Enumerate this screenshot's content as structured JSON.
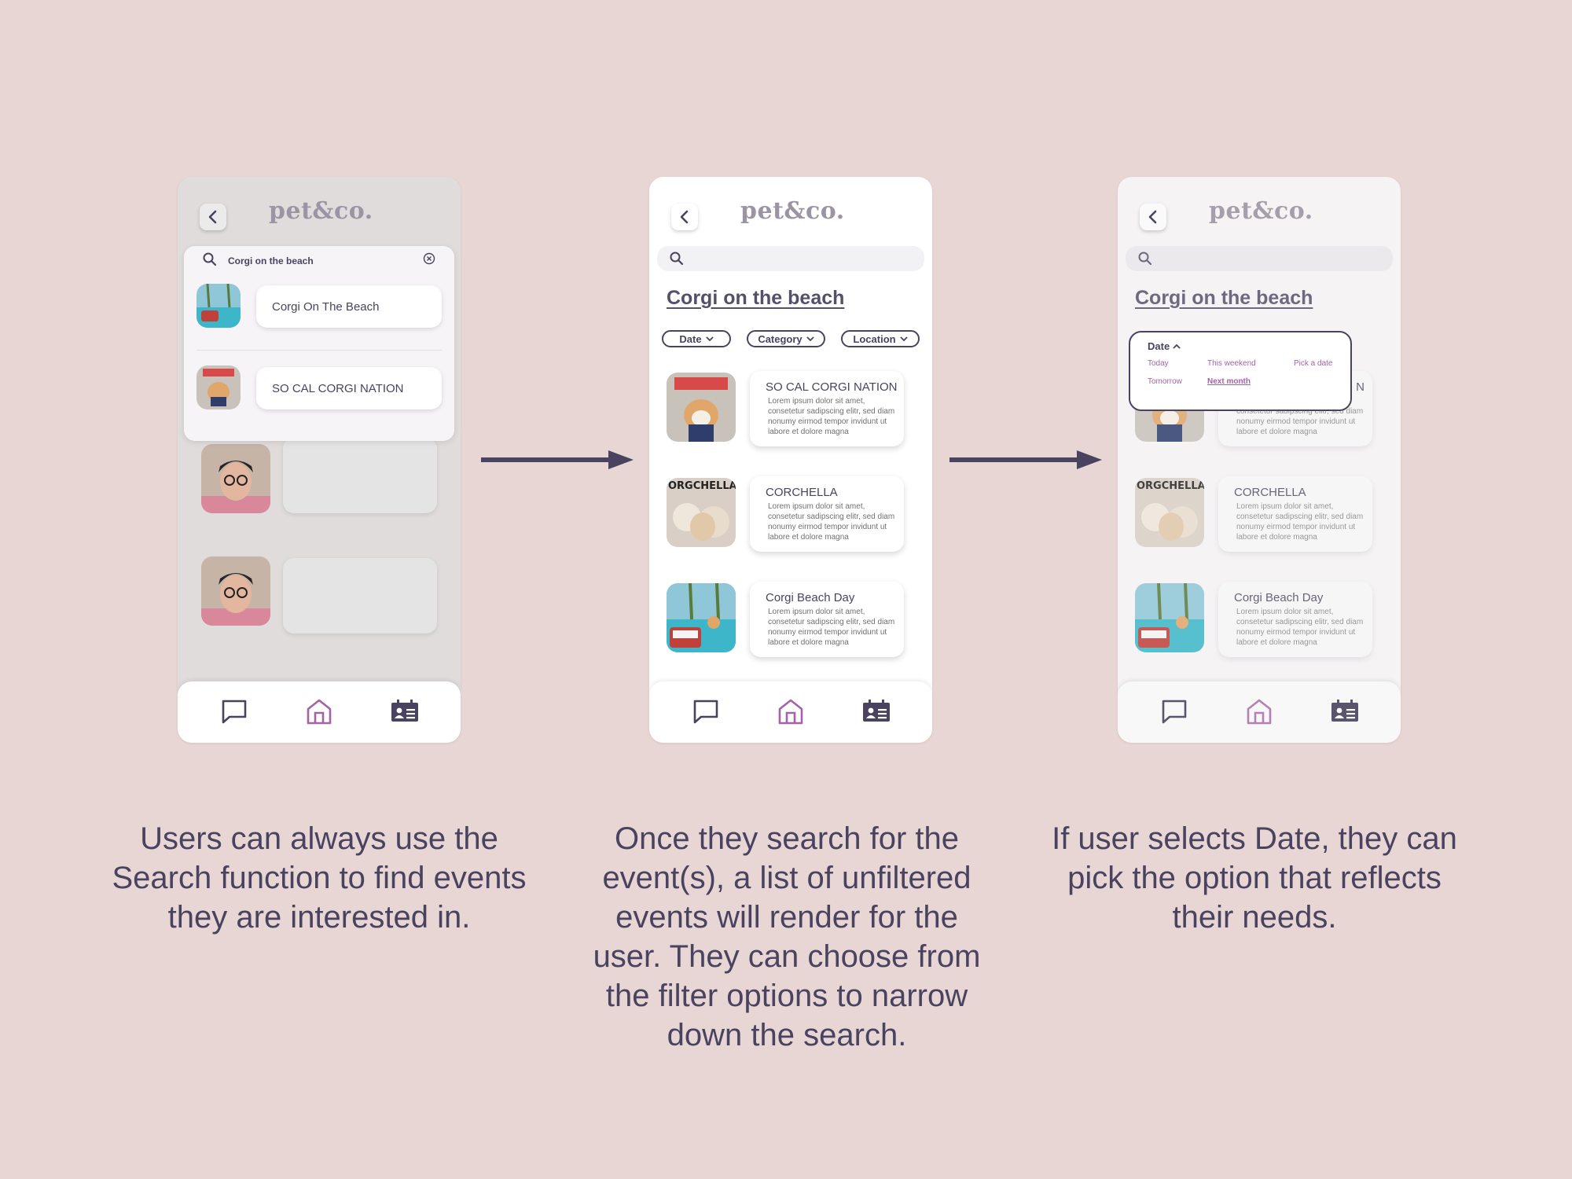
{
  "brand": {
    "logo": "pet&co.",
    "accent": "#a463a4",
    "dark": "#4a4360",
    "background": "#e8d6d4"
  },
  "screen1": {
    "search_query": "Corgi on the beach",
    "results": [
      {
        "label": "Corgi On The Beach"
      },
      {
        "label": "SO CAL CORGI NATION"
      }
    ]
  },
  "screen2": {
    "heading": "Corgi on the beach",
    "filters": [
      {
        "label": "Date"
      },
      {
        "label": "Category"
      },
      {
        "label": "Location"
      }
    ],
    "events": [
      {
        "title": "SO CAL CORGI NATION",
        "desc": "Lorem ipsum dolor sit amet, consetetur sadipscing elitr, sed diam nonumy eirmod tempor invidunt ut labore et dolore magna"
      },
      {
        "title": "CORCHELLA",
        "desc": "Lorem ipsum dolor sit amet, consetetur sadipscing elitr, sed diam nonumy eirmod tempor invidunt ut labore et dolore magna"
      },
      {
        "title": "Corgi Beach Day",
        "desc": "Lorem ipsum dolor sit amet, consetetur sadipscing elitr, sed diam nonumy eirmod tempor invidunt ut labore et dolore magna"
      }
    ]
  },
  "screen3": {
    "heading": "Corgi on the beach",
    "date_filter": {
      "title": "Date",
      "options": [
        "Today",
        "This weekend",
        "Pick a date",
        "Tomorrow",
        "Next month"
      ],
      "selected": "Next month"
    },
    "events": [
      {
        "title": "CORCHELLA",
        "desc": "Lorem ipsum dolor sit amet, consetetur sadipscing elitr, sed diam nonumy eirmod tempor invidunt ut labore et dolore magna"
      },
      {
        "title": "Corgi Beach Day",
        "desc": "Lorem ipsum dolor sit amet, consetetur sadipscing elitr, sed diam nonumy eirmod tempor invidunt ut labore et dolore magna"
      }
    ],
    "partial_card": {
      "title_fragment": "N",
      "desc": "Lorem ipsum dolor sit amet, consetetur sadipscing elitr, sed diam nonumy eirmod tempor invidunt ut labore et dolore magna"
    }
  },
  "nav_icons": [
    "chat-icon",
    "home-icon",
    "id-card-icon"
  ],
  "captions": [
    "Users can always use the Search function to find events they are interested in.",
    "Once they search for the event(s), a list of unfiltered events will render for the user. They can choose from the filter options to narrow down the search.",
    "If user selects Date, they can pick the option that reflects their needs."
  ]
}
